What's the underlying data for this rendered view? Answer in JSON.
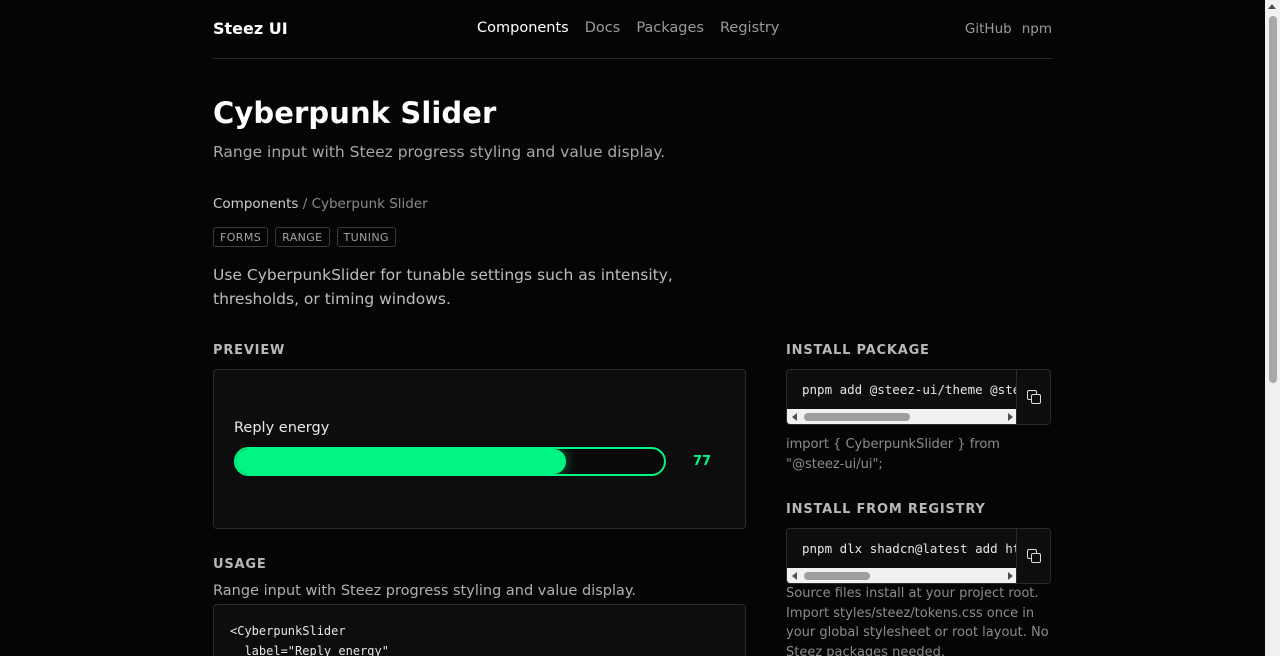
{
  "header": {
    "brand": "Steez UI",
    "nav": [
      "Components",
      "Docs",
      "Packages",
      "Registry"
    ],
    "external": [
      "GitHub",
      "npm"
    ]
  },
  "page": {
    "title": "Cyberpunk Slider",
    "subtitle": "Range input with Steez progress styling and value display.",
    "breadcrumb_link": "Components",
    "breadcrumb_sep": " / ",
    "breadcrumb_current": "Cyberpunk Slider",
    "tags": [
      "FORMS",
      "RANGE",
      "TUNING"
    ],
    "description": "Use CyberpunkSlider for tunable settings such as intensity, thresholds, or timing windows."
  },
  "preview": {
    "section_label": "PREVIEW",
    "slider_label": "Reply energy",
    "slider_value": "77",
    "slider_fraction": 0.77,
    "accent": "#00f582"
  },
  "usage": {
    "section_label": "USAGE",
    "text": "Range input with Steez progress styling and value display.",
    "code": "<CyberpunkSlider\n  label=\"Reply energy\""
  },
  "install": {
    "package_label": "INSTALL PACKAGE",
    "package_cmd": "pnpm add @steez-ui/theme @ste",
    "import_text": "import { CyberpunkSlider } from \"@steez-ui/ui\";",
    "registry_label": "INSTALL FROM REGISTRY",
    "registry_cmd": "pnpm dlx shadcn@latest add ht",
    "notes": "Source files install at your project root. Import styles/steez/tokens.css once in your global stylesheet or root layout. No Steez packages needed."
  }
}
